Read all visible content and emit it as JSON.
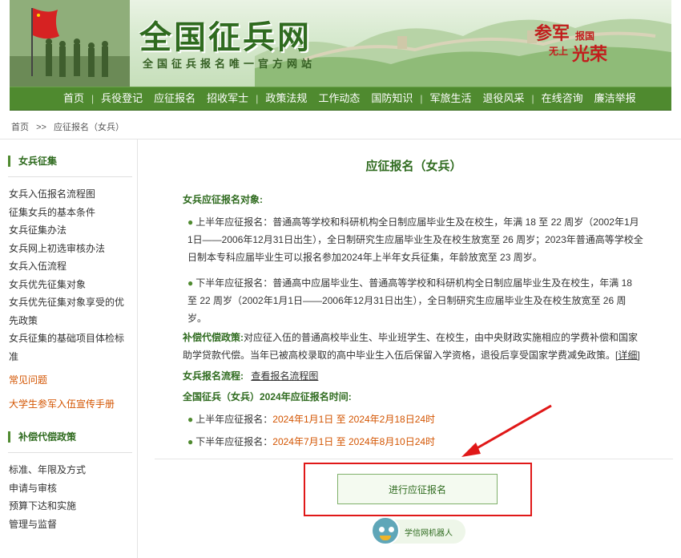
{
  "banner": {
    "title": "全国征兵网",
    "subtitle": "全国征兵报名唯一官方网站",
    "slogan_big1": "参军",
    "slogan_small1": "报国",
    "slogan_small2": "无上",
    "slogan_big2": "光荣"
  },
  "nav": {
    "items": [
      "首页",
      "兵役登记",
      "应征报名",
      "招收军士",
      "政策法规",
      "工作动态",
      "国防知识",
      "军旅生活",
      "退役风采",
      "在线咨询",
      "廉洁举报"
    ]
  },
  "breadcrumb": {
    "home": "首页",
    "sep": ">>",
    "current": "应征报名（女兵）"
  },
  "sidebar": {
    "section1_title": "女兵征集",
    "section1_items": [
      "女兵入伍报名流程图",
      "征集女兵的基本条件",
      "女兵征集办法",
      "女兵网上初选审核办法",
      "女兵入伍流程",
      "女兵优先征集对象",
      "女兵优先征集对象享受的优先政策",
      "女兵征集的基础项目体检标准"
    ],
    "faq": "常见问题",
    "handbook": "大学生参军入伍宣传手册",
    "section2_title": "补偿代偿政策",
    "section2_items": [
      "标准、年限及方式",
      "申请与审核",
      "预算下达和实施",
      "管理与监督"
    ]
  },
  "main": {
    "title": "应征报名（女兵）",
    "target_label": "女兵应征报名对象:",
    "first_half": "上半年应征报名：普通高等学校和科研机构全日制应届毕业生及在校生，年满 18 至 22 周岁（2002年1月1日——2006年12月31日出生），全日制研究生应届毕业生及在校生放宽至 26 周岁；2023年普通高等学校全日制本专科应届毕业生可以报名参加2024年上半年女兵征集，年龄放宽至 23 周岁。",
    "second_half": "下半年应征报名：普通高中应届毕业生、普通高等学校和科研机构全日制应届毕业生及在校生，年满 18 至 22 周岁（2002年1月1日——2006年12月31日出生），全日制研究生应届毕业生及在校生放宽至 26 周岁。",
    "compensation_label": "补偿代偿政策:",
    "compensation_text": "对应征入伍的普通高校毕业生、毕业班学生、在校生，由中央财政实施相应的学费补偿和国家助学贷款代偿。当年已被高校录取的高中毕业生入伍后保留入学资格，退役后享受国家学费减免政策。",
    "detail_link": "[详细]",
    "process_label": "女兵报名流程:",
    "process_link": "查看报名流程图",
    "time_label": "全国征兵（女兵）2024年应征报名时间:",
    "first_time_label": "上半年应征报名：",
    "first_time": "2024年1月1日 至 2024年2月18日24时",
    "second_time_label": "下半年应征报名：",
    "second_time": "2024年7月1日 至 2024年8月10日24时",
    "cta": "进行应征报名",
    "robot": "学信网机器人"
  },
  "colors": {
    "brand_green": "#4f8a2f",
    "dark_green": "#2f6b1f",
    "orange": "#d35400",
    "highlight_red": "#e01818"
  }
}
